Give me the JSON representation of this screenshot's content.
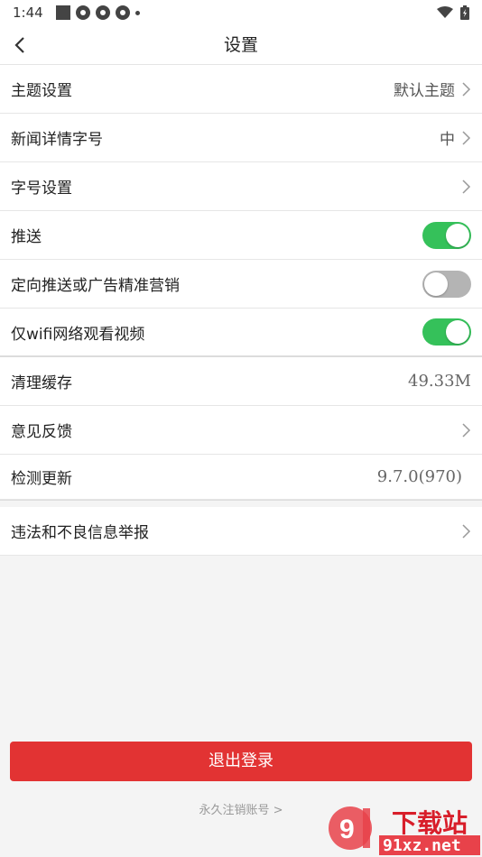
{
  "status_bar": {
    "time": "1:44"
  },
  "header": {
    "title": "设置"
  },
  "rows": {
    "theme": {
      "label": "主题设置",
      "value": "默认主题"
    },
    "font_detail": {
      "label": "新闻详情字号",
      "value": "中"
    },
    "font_size": {
      "label": "字号设置"
    },
    "push": {
      "label": "推送",
      "enabled": true
    },
    "targeted_push": {
      "label": "定向推送或广告精准营销",
      "enabled": false
    },
    "wifi_only": {
      "label": "仅wifi网络观看视频",
      "enabled": true
    },
    "clear_cache": {
      "label": "清理缓存",
      "value": "49.33M"
    },
    "feedback": {
      "label": "意见反馈"
    },
    "check_update": {
      "label": "检测更新",
      "value": "9.7.0(970)"
    },
    "report": {
      "label": "违法和不良信息举报"
    }
  },
  "logout_button": {
    "label": "退出登录"
  },
  "deactivate_link": {
    "label": "永久注销账号 >"
  },
  "watermark": {
    "brand": "下载站",
    "domain": "91xz.net"
  },
  "colors": {
    "accent_red": "#e23333",
    "toggle_on": "#35c15a",
    "toggle_off": "#b4b4b4"
  }
}
